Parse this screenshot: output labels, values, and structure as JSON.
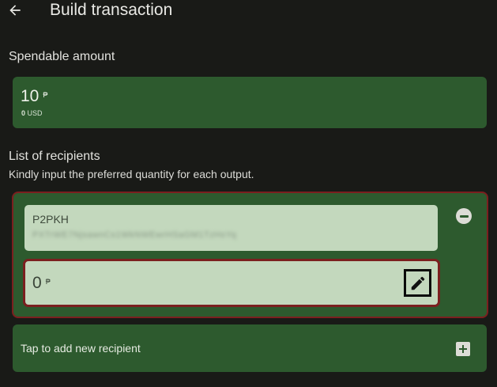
{
  "appbar": {
    "back_icon": "arrow-left-icon",
    "title": "Build transaction"
  },
  "spendable": {
    "label": "Spendable amount",
    "amount": "10",
    "unit": "₱",
    "fiat_value": "0",
    "fiat_currency": "USD"
  },
  "recipients": {
    "title": "List of recipients",
    "subtitle": "Kindly input the preferred quantity for each output.",
    "items": [
      {
        "type": "P2PKH",
        "address": "PXTrWE7NjsawnCs1WkNWEwrHSaGM1TzHsYq",
        "amount": "0",
        "unit": "₱",
        "remove_icon": "minus-circle-icon",
        "edit_icon": "pencil-icon"
      }
    ],
    "add_label": "Tap to add new recipient",
    "add_icon": "plus-square-icon"
  },
  "colors": {
    "background": "#191a17",
    "card_green": "#2d5a2e",
    "field_light": "#c3d8bd",
    "error_border": "#7b1f1f"
  }
}
